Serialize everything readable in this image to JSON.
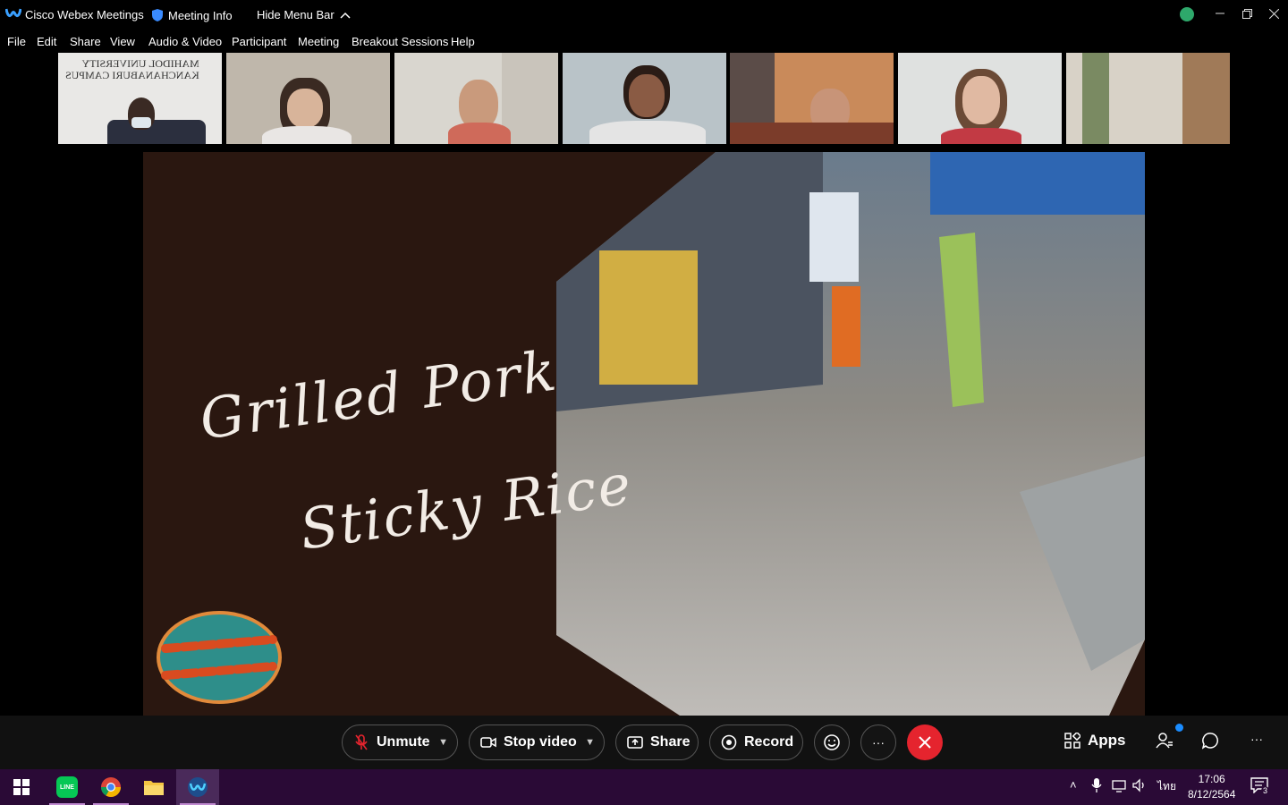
{
  "titlebar": {
    "app_title": "Cisco Webex Meetings",
    "meeting_info": "Meeting Info",
    "hide_menu": "Hide Menu Bar"
  },
  "menu": [
    "File",
    "Edit",
    "Share",
    "View",
    "Audio & Video",
    "Participant",
    "Meeting",
    "Breakout Sessions",
    "Help"
  ],
  "thumbnails": {
    "sign_line1": "MAHIDOL UNIVERSITY",
    "sign_line2": "KANCHANABURI CAMPUS"
  },
  "slide": {
    "line1": "Grilled Pork",
    "line2": "Sticky Rice"
  },
  "controls": {
    "unmute": "Unmute",
    "stop_video": "Stop video",
    "share": "Share",
    "record": "Record",
    "more": "···",
    "apps": "Apps",
    "overflow": "···"
  },
  "taskbar": {
    "lang": "ไทย",
    "time": "17:06",
    "date": "8/12/2564",
    "notif_count": "3"
  },
  "colors": {
    "end_button": "#e5242e",
    "slide_bg": "#2a1710",
    "taskbar_bg": "#2a0a36"
  }
}
